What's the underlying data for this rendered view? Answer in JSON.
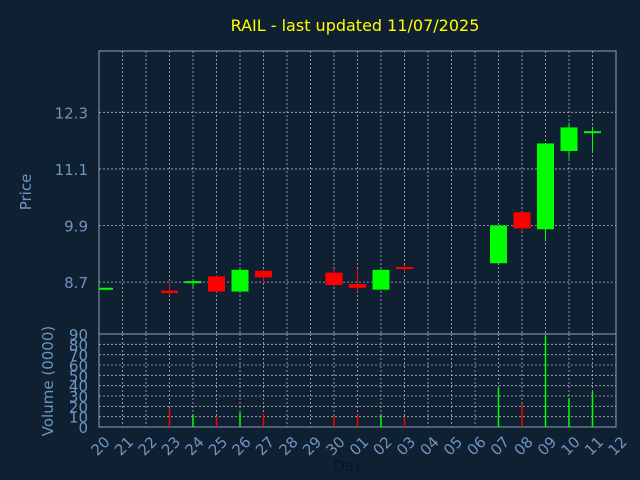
{
  "title": "RAIL - last updated 11/07/2025",
  "colors": {
    "background": "#0f2033",
    "title": "#ffff00",
    "axis_text": "#6f95bd",
    "grid": "#c8d0da",
    "frame": "#8aa0b8",
    "up": "#00ff00",
    "down": "#ff0000"
  },
  "chart_data": [
    {
      "type": "candlestick",
      "title": "RAIL - last updated 11/07/2025",
      "ylabel": "Price",
      "xlabel": "",
      "ylim": [
        7.6,
        13.6
      ],
      "yticks": [
        8.7,
        9.9,
        11.1,
        12.3
      ],
      "ytick_labels": [
        "8.7",
        "9.9",
        "11.1",
        "12.3"
      ],
      "x": [
        "20",
        "21",
        "22",
        "23",
        "24",
        "25",
        "26",
        "27",
        "28",
        "29",
        "30",
        "01",
        "02",
        "03",
        "04",
        "05",
        "06",
        "07",
        "08",
        "09",
        "10",
        "11",
        "12"
      ],
      "candles": [
        {
          "x": "20",
          "open": 8.58,
          "high": 8.58,
          "low": 8.58,
          "close": 8.58
        },
        {
          "x": "23",
          "open": 8.52,
          "high": 8.68,
          "low": 8.42,
          "close": 8.47
        },
        {
          "x": "24",
          "open": 8.68,
          "high": 8.76,
          "low": 8.56,
          "close": 8.72
        },
        {
          "x": "25",
          "open": 8.82,
          "high": 8.85,
          "low": 8.48,
          "close": 8.5
        },
        {
          "x": "26",
          "open": 8.5,
          "high": 9.0,
          "low": 8.5,
          "close": 8.96
        },
        {
          "x": "27",
          "open": 8.94,
          "high": 8.96,
          "low": 8.68,
          "close": 8.8
        },
        {
          "x": "30",
          "open": 8.9,
          "high": 8.98,
          "low": 8.62,
          "close": 8.64
        },
        {
          "x": "01",
          "open": 8.66,
          "high": 8.98,
          "low": 8.5,
          "close": 8.58
        },
        {
          "x": "02",
          "open": 8.54,
          "high": 8.98,
          "low": 8.54,
          "close": 8.96
        },
        {
          "x": "03",
          "open": 9.02,
          "high": 9.06,
          "low": 8.9,
          "close": 8.98
        },
        {
          "x": "07",
          "open": 9.1,
          "high": 9.9,
          "low": 9.1,
          "close": 9.9
        },
        {
          "x": "08",
          "open": 10.18,
          "high": 10.18,
          "low": 9.78,
          "close": 9.84
        },
        {
          "x": "09",
          "open": 9.82,
          "high": 11.64,
          "low": 9.56,
          "close": 11.64
        },
        {
          "x": "10",
          "open": 11.48,
          "high": 12.08,
          "low": 11.32,
          "close": 11.98
        },
        {
          "x": "11",
          "open": 11.88,
          "high": 12.0,
          "low": 11.45,
          "close": 11.9
        }
      ]
    },
    {
      "type": "bar",
      "ylabel": "Volume (0000)",
      "xlabel": "Day",
      "ylim": [
        0,
        90
      ],
      "yticks": [
        0,
        10,
        20,
        30,
        40,
        50,
        60,
        70,
        80,
        90
      ],
      "ytick_labels": [
        "0",
        "10",
        "20",
        "30",
        "40",
        "50",
        "60",
        "70",
        "80",
        "90"
      ],
      "categories": [
        "20",
        "21",
        "22",
        "23",
        "24",
        "25",
        "26",
        "27",
        "28",
        "29",
        "30",
        "01",
        "02",
        "03",
        "04",
        "05",
        "06",
        "07",
        "08",
        "09",
        "10",
        "11",
        "12"
      ],
      "bars": [
        {
          "x": "23",
          "value": 18,
          "direction": "down"
        },
        {
          "x": "24",
          "value": 12,
          "direction": "up"
        },
        {
          "x": "25",
          "value": 10,
          "direction": "down"
        },
        {
          "x": "26",
          "value": 14,
          "direction": "up"
        },
        {
          "x": "27",
          "value": 13,
          "direction": "down"
        },
        {
          "x": "30",
          "value": 11,
          "direction": "down"
        },
        {
          "x": "01",
          "value": 12,
          "direction": "down"
        },
        {
          "x": "02",
          "value": 12,
          "direction": "up"
        },
        {
          "x": "03",
          "value": 9,
          "direction": "down"
        },
        {
          "x": "07",
          "value": 38,
          "direction": "up"
        },
        {
          "x": "08",
          "value": 22,
          "direction": "down"
        },
        {
          "x": "09",
          "value": 88,
          "direction": "up"
        },
        {
          "x": "10",
          "value": 28,
          "direction": "up"
        },
        {
          "x": "11",
          "value": 34,
          "direction": "up"
        }
      ]
    }
  ]
}
